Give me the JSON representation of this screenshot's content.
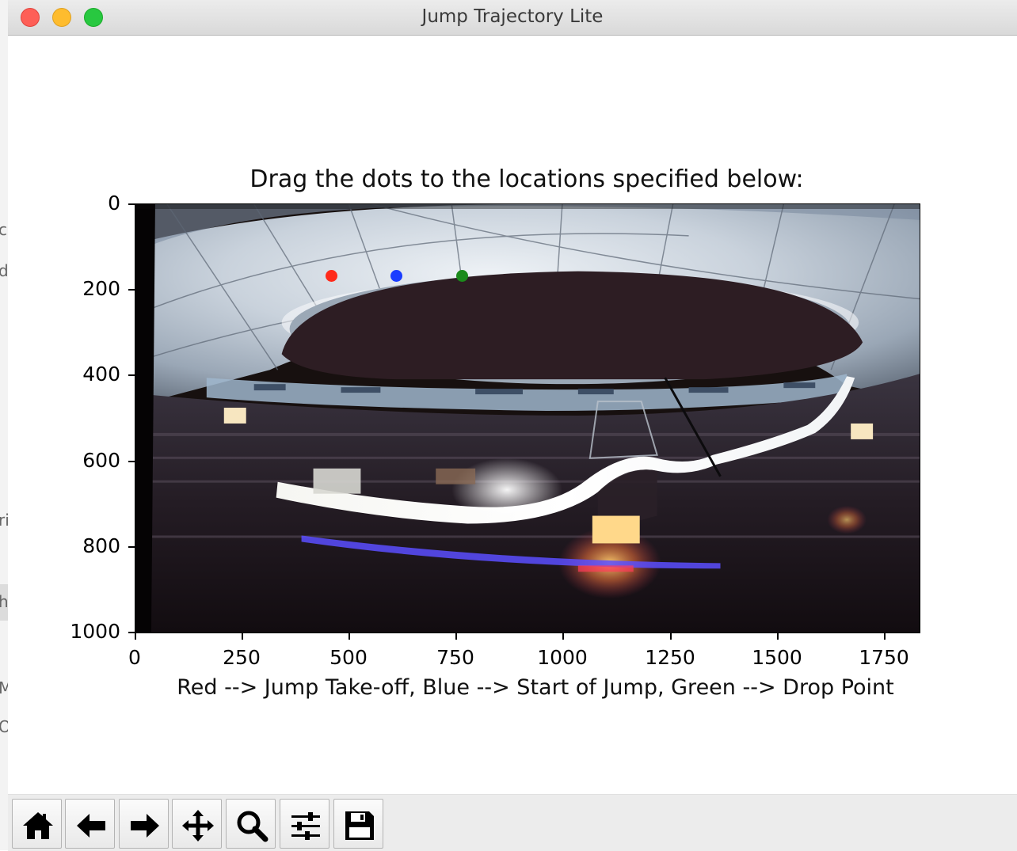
{
  "window": {
    "title": "Jump Trajectory Lite"
  },
  "background_window": {
    "fragments": [
      "c",
      "d",
      "ri",
      "h",
      "M",
      "O"
    ]
  },
  "plot": {
    "title": "Drag the dots to the locations specified below:",
    "xlabel": "Red --> Jump Take-off, Blue --> Start of Jump, Green --> Drop Point",
    "x_ticks": [
      "0",
      "250",
      "500",
      "750",
      "1000",
      "1250",
      "1500",
      "1750"
    ],
    "y_ticks": [
      "0",
      "200",
      "400",
      "600",
      "800",
      "1000"
    ],
    "image_extent": {
      "x": [
        0,
        1835
      ],
      "y": [
        1000,
        0
      ]
    },
    "image_description": "Night photo of an indoor stadium with a big air ski-jump ramp",
    "markers": [
      {
        "name": "red",
        "color": "#ff2a1a",
        "x": 460,
        "y": 168
      },
      {
        "name": "blue",
        "color": "#1a3dff",
        "x": 612,
        "y": 168
      },
      {
        "name": "green",
        "color": "#1b8a1b",
        "x": 765,
        "y": 168
      }
    ]
  },
  "toolbar": {
    "buttons": [
      {
        "name": "home",
        "icon": "home-icon"
      },
      {
        "name": "back",
        "icon": "arrow-left-icon"
      },
      {
        "name": "forward",
        "icon": "arrow-right-icon"
      },
      {
        "name": "pan",
        "icon": "move-icon"
      },
      {
        "name": "zoom",
        "icon": "magnifier-icon"
      },
      {
        "name": "configure",
        "icon": "sliders-icon"
      },
      {
        "name": "save",
        "icon": "floppy-icon"
      }
    ]
  }
}
